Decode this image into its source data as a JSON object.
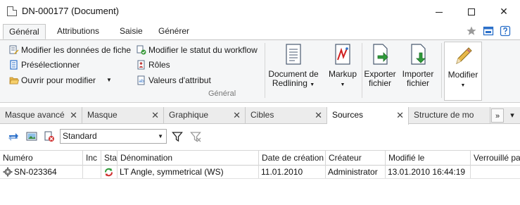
{
  "window": {
    "title": "DN-000177 (Document)"
  },
  "ribbon": {
    "tabs": [
      {
        "label": "Général",
        "active": true
      },
      {
        "label": "Attributions",
        "active": false
      },
      {
        "label": "Saisie",
        "active": false
      },
      {
        "label": "Générer",
        "active": false
      }
    ],
    "commands": [
      {
        "label": "Modifier les données de fiche",
        "icon": "edit-record-icon"
      },
      {
        "label": "Présélectionner",
        "icon": "preselect-icon"
      },
      {
        "label": "Ouvrir pour modifier",
        "icon": "folder-open-icon"
      },
      {
        "label": "Modifier le statut du workflow",
        "icon": "workflow-status-icon"
      },
      {
        "label": "Rôles",
        "icon": "roles-icon"
      },
      {
        "label": "Valeurs d'attribut",
        "icon": "attribute-values-icon"
      }
    ],
    "group_label": "Général",
    "large_buttons": [
      {
        "line1": "Document de",
        "line2": "Redlining",
        "has_dropdown": true,
        "icon": "document-redlining-icon"
      },
      {
        "line1": "Markup",
        "line2": "",
        "has_dropdown": true,
        "icon": "markup-icon"
      },
      {
        "line1": "Exporter",
        "line2": "fichier",
        "has_dropdown": false,
        "icon": "export-file-icon"
      },
      {
        "line1": "Importer",
        "line2": "fichier",
        "has_dropdown": false,
        "icon": "import-file-icon"
      },
      {
        "line1": "Modifier",
        "line2": "",
        "has_dropdown": true,
        "icon": "pencil-icon"
      }
    ]
  },
  "panel_tabs": [
    {
      "label": "Masque avancé",
      "closable": true,
      "active": false
    },
    {
      "label": "Masque",
      "closable": true,
      "active": false
    },
    {
      "label": "Graphique",
      "closable": true,
      "active": false
    },
    {
      "label": "Cibles",
      "closable": true,
      "active": false
    },
    {
      "label": "Sources",
      "closable": true,
      "active": true
    },
    {
      "label": "Structure de mo",
      "closable": false,
      "active": false
    }
  ],
  "panel_nav": {
    "overflow": "»",
    "dropdown": "▾"
  },
  "toolbar": {
    "filter_value": "Standard"
  },
  "grid": {
    "columns": [
      "Numéro",
      "Inc",
      "Sta",
      "Dénomination",
      "Date de création",
      "Créateur",
      "Modifié le",
      "Verrouillé pa"
    ],
    "rows": [
      {
        "number": "SN-023364",
        "inc": "",
        "sta": "",
        "denomination": "LT Angle, symmetrical (WS)",
        "created": "11.01.2010",
        "creator": "Administrator",
        "modified": "13.01.2010 16:44:19",
        "locked": ""
      }
    ]
  },
  "colors": {
    "accent": "#2a6fc9",
    "ribbon_bg": "#f5f6f7",
    "tab_strip_bg": "#ececec"
  }
}
